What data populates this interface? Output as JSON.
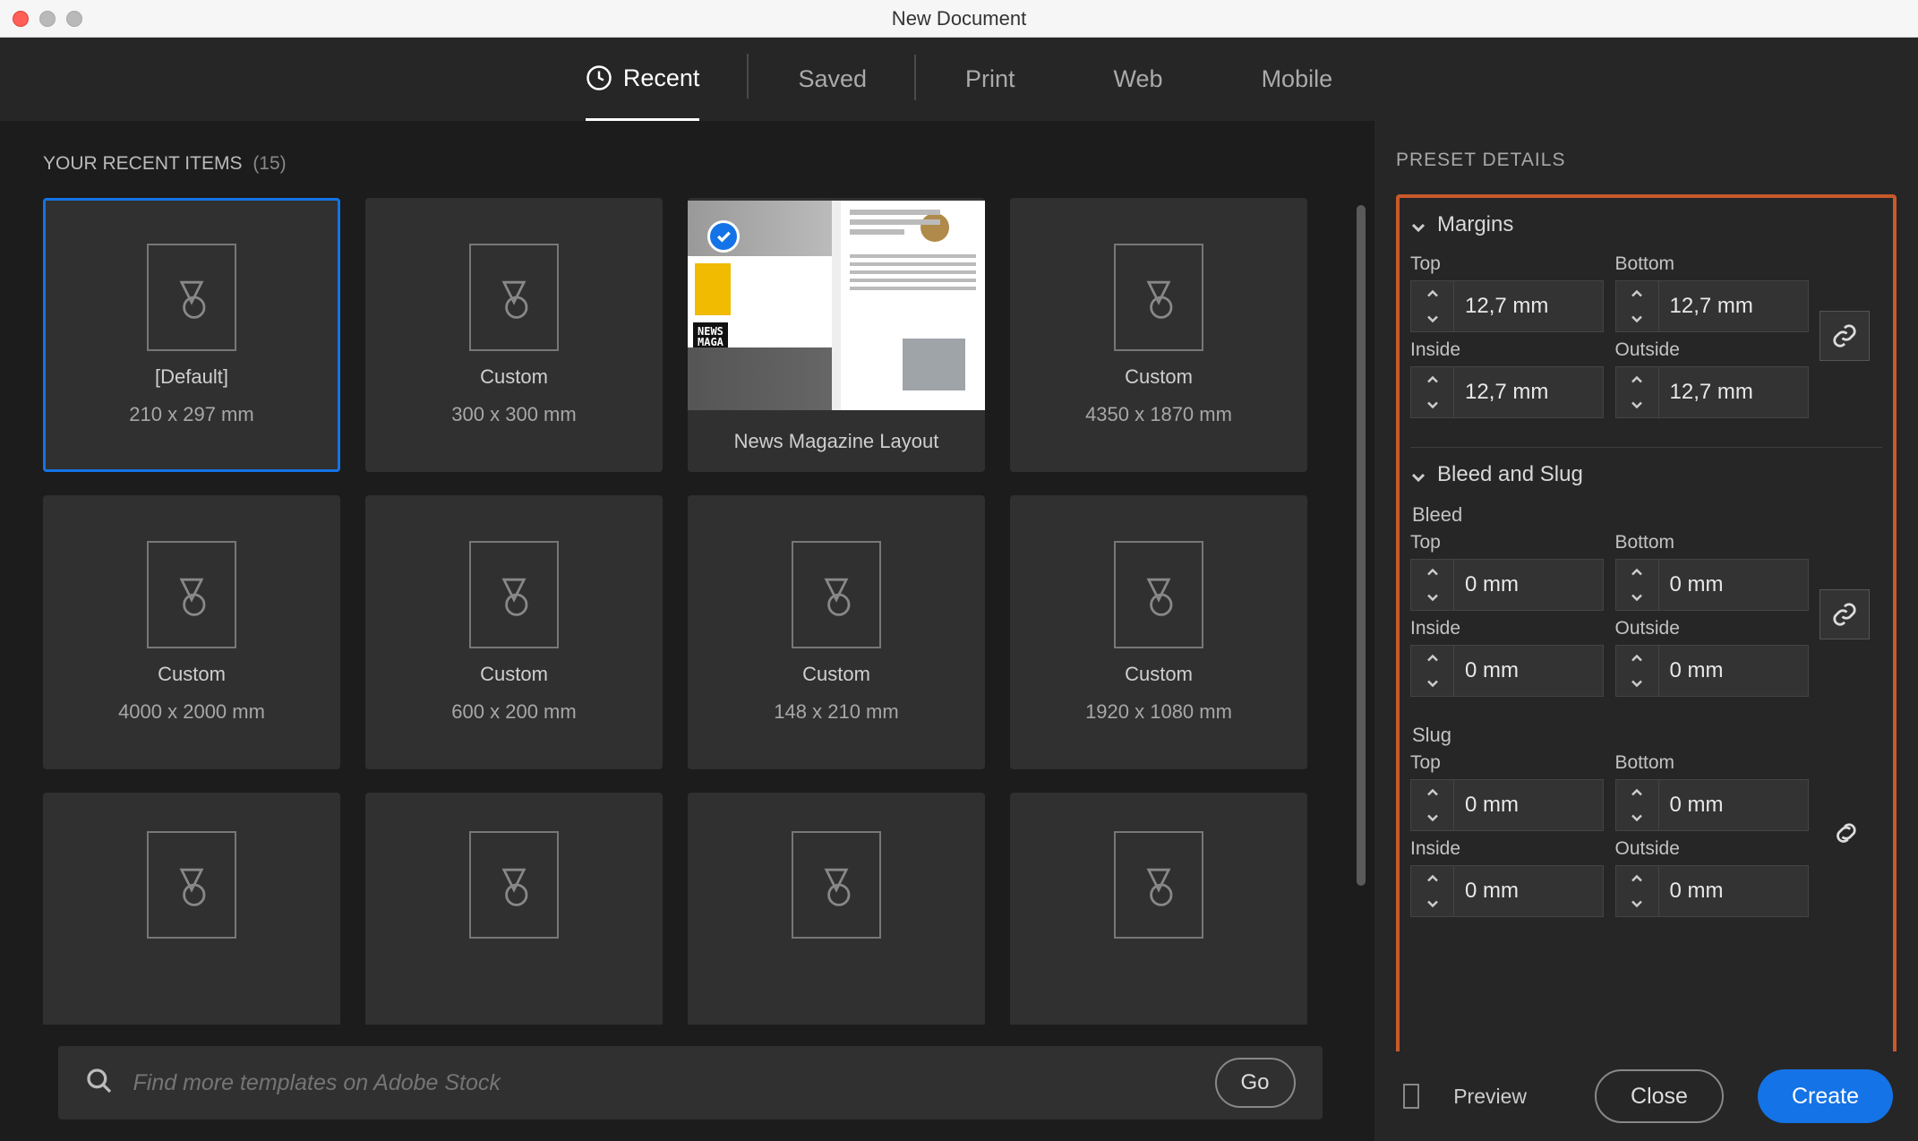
{
  "window": {
    "title": "New Document"
  },
  "tabs": {
    "recent": "Recent",
    "saved": "Saved",
    "print": "Print",
    "web": "Web",
    "mobile": "Mobile"
  },
  "left": {
    "section_title": "YOUR RECENT ITEMS",
    "section_count": "(15)",
    "cards": [
      {
        "name": "[Default]",
        "dim": "210 x 297 mm"
      },
      {
        "name": "Custom",
        "dim": "300 x 300 mm"
      },
      {
        "name": "News Magazine Layout",
        "dim": ""
      },
      {
        "name": "Custom",
        "dim": "4350 x 1870 mm"
      },
      {
        "name": "Custom",
        "dim": "4000 x 2000 mm"
      },
      {
        "name": "Custom",
        "dim": "600 x 200 mm"
      },
      {
        "name": "Custom",
        "dim": "148 x 210 mm"
      },
      {
        "name": "Custom",
        "dim": "1920 x 1080 mm"
      }
    ],
    "search_placeholder": "Find more templates on Adobe Stock",
    "go_label": "Go"
  },
  "right": {
    "panel_title": "PRESET DETAILS",
    "margins": {
      "title": "Margins",
      "top_lbl": "Top",
      "bottom_lbl": "Bottom",
      "inside_lbl": "Inside",
      "outside_lbl": "Outside",
      "top": "12,7 mm",
      "bottom": "12,7 mm",
      "inside": "12,7 mm",
      "outside": "12,7 mm"
    },
    "bleed_slug": {
      "title": "Bleed and Slug",
      "bleed_lbl": "Bleed",
      "slug_lbl": "Slug",
      "top_lbl": "Top",
      "bottom_lbl": "Bottom",
      "inside_lbl": "Inside",
      "outside_lbl": "Outside",
      "bleed": {
        "top": "0 mm",
        "bottom": "0 mm",
        "inside": "0 mm",
        "outside": "0 mm"
      },
      "slug": {
        "top": "0 mm",
        "bottom": "0 mm",
        "inside": "0 mm",
        "outside": "0 mm"
      }
    },
    "preview_lbl": "Preview",
    "close_lbl": "Close",
    "create_lbl": "Create"
  }
}
